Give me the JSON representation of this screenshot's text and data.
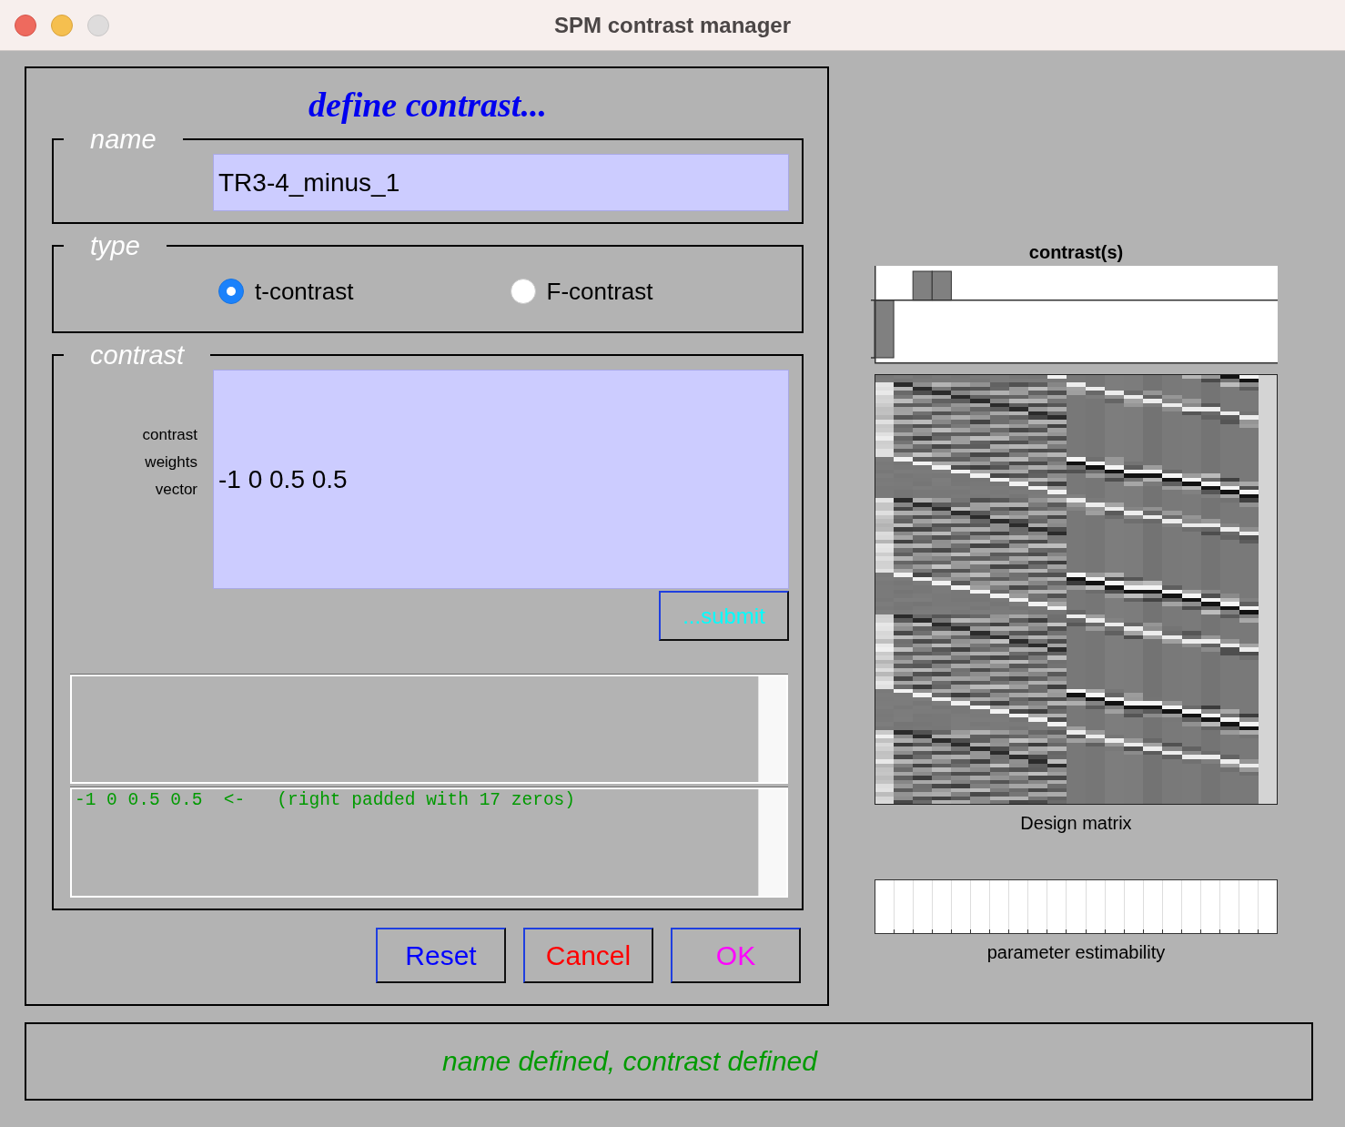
{
  "window": {
    "title": "SPM contrast manager",
    "zoom_disabled": true
  },
  "heading": "define contrast...",
  "name_section": {
    "legend": "name",
    "value": "TR3-4_minus_1"
  },
  "type_section": {
    "legend": "type",
    "options": [
      {
        "label": "t-contrast",
        "selected": true
      },
      {
        "label": "F-contrast",
        "selected": false
      }
    ]
  },
  "contrast_section": {
    "legend": "contrast",
    "field_label": "contrast weights vector",
    "value": "-1 0 0.5 0.5",
    "submit": "...submit",
    "messages": [
      "-1 0 0.5 0.5  <-   (right padded with 17 zeros)"
    ]
  },
  "buttons": [
    {
      "label": "Reset",
      "color": "#0000ff"
    },
    {
      "label": "Cancel",
      "color": "#ff0000"
    },
    {
      "label": "OK",
      "color": "#ff00ff"
    }
  ],
  "status": "name defined, contrast defined",
  "preview": {
    "contrast_title": "contrast(s)",
    "design_matrix_caption": "Design matrix",
    "estimability_caption": "parameter estimability",
    "parameters": [
      {
        "estimable": true
      },
      {
        "estimable": true
      },
      {
        "estimable": true
      },
      {
        "estimable": true
      },
      {
        "estimable": true
      },
      {
        "estimable": true
      },
      {
        "estimable": true
      },
      {
        "estimable": true
      },
      {
        "estimable": true
      },
      {
        "estimable": true
      },
      {
        "estimable": true
      },
      {
        "estimable": true
      },
      {
        "estimable": true
      },
      {
        "estimable": true
      },
      {
        "estimable": true
      },
      {
        "estimable": true
      },
      {
        "estimable": true
      },
      {
        "estimable": true
      },
      {
        "estimable": true
      },
      {
        "estimable": true
      },
      {
        "estimable": true
      }
    ]
  }
}
